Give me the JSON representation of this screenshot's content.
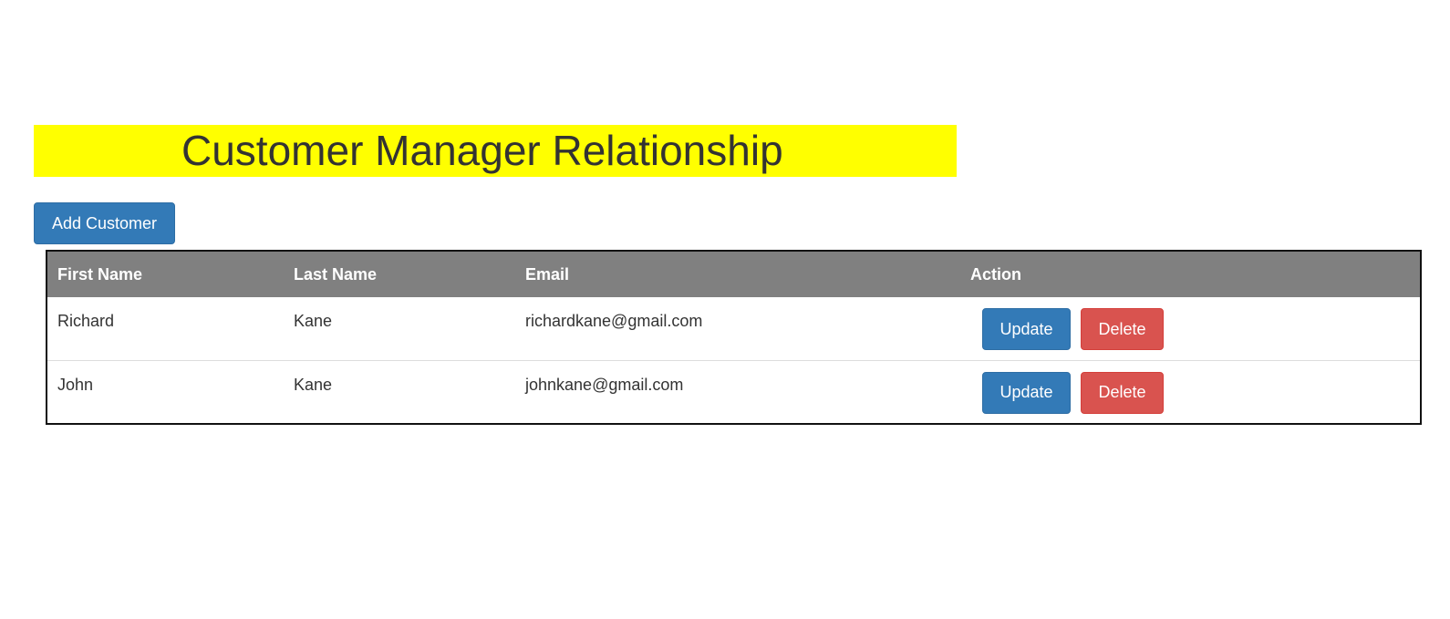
{
  "header": {
    "title": "Customer Manager Relationship",
    "banner_color": "#ffff00"
  },
  "toolbar": {
    "add_label": "Add Customer"
  },
  "table": {
    "columns": [
      "First Name",
      "Last Name",
      "Email",
      "Action"
    ],
    "header_color": "#808080",
    "rows": [
      {
        "first_name": "Richard",
        "last_name": "Kane",
        "email": "richardkane@gmail.com",
        "update_label": "Update",
        "delete_label": "Delete"
      },
      {
        "first_name": "John",
        "last_name": "Kane",
        "email": "johnkane@gmail.com",
        "update_label": "Update",
        "delete_label": "Delete"
      }
    ]
  },
  "colors": {
    "primary": "#337ab7",
    "danger": "#d9534f"
  }
}
